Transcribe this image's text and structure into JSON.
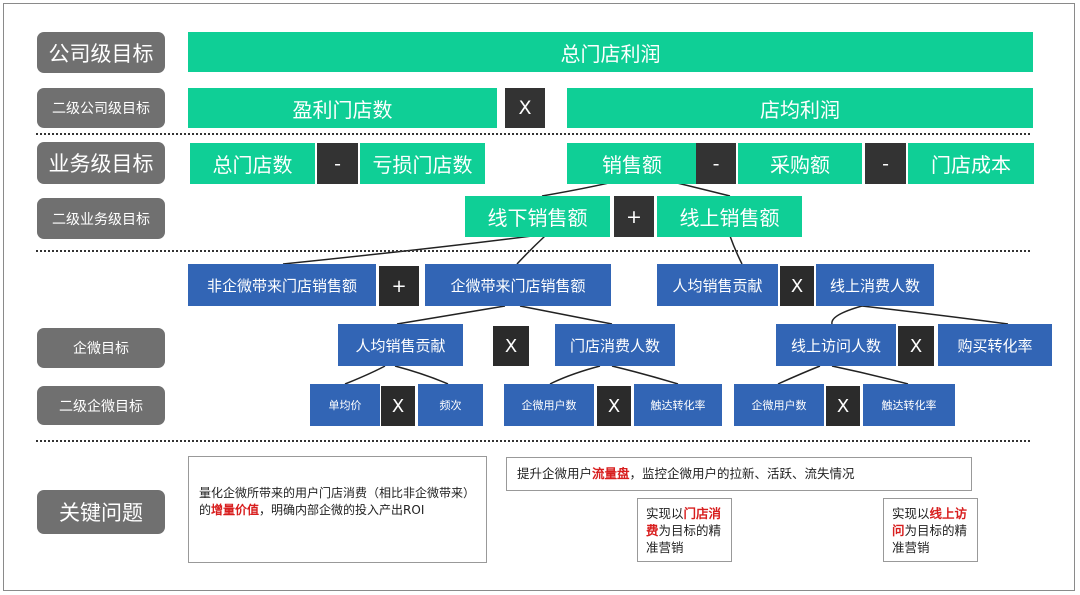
{
  "levels": {
    "company": "公司级目标",
    "company2": "二级公司级目标",
    "business": "业务级目标",
    "business2": "二级业务级目标",
    "wecom": "企微目标",
    "wecom2": "二级企微目标",
    "key": "关键问题"
  },
  "green": {
    "total_profit": "总门店利润",
    "profitable_stores": "盈利门店数",
    "avg_profit": "店均利润",
    "total_stores": "总门店数",
    "loss_stores": "亏损门店数",
    "sales": "销售额",
    "purchase": "采购额",
    "store_cost": "门店成本",
    "offline_sales": "线下销售额",
    "online_sales": "线上销售额"
  },
  "ops": {
    "times": "X",
    "minus": "-",
    "plus": "+"
  },
  "blue": {
    "non_wecom_sales": "非企微带来门店销售额",
    "wecom_sales": "企微带来门店销售额",
    "per_capita_left": "人均销售贡献",
    "online_consumers": "线上消费人数",
    "per_capita_mid": "人均销售贡献",
    "store_consumers": "门店消费人数",
    "online_visitors": "线上访问人数",
    "purchase_rate": "购买转化率",
    "unit_price": "单均价",
    "frequency": "频次",
    "wecom_users_a": "企微用户数",
    "reach_rate_a": "触达转化率",
    "wecom_users_b": "企微用户数",
    "reach_rate_b": "触达转化率"
  },
  "notes": {
    "left_a": "量化企微所带来的用户门店消费（相比非企微带来）的",
    "left_hl": "增量价值",
    "left_b": "，明确内部企微的投入产出ROI",
    "top_a": "提升企微用户",
    "top_hl": "流量盘",
    "top_b": "，监控企微用户的拉新、活跃、流失情况",
    "store_a": "实现以",
    "store_hl": "门店消费",
    "store_b": "为目标的精准营销",
    "online_a": "实现以",
    "online_hl": "线上访问",
    "online_b": "为目标的精准营销"
  },
  "colors": {
    "green": "#0fcf96",
    "blue": "#3265b5",
    "dark": "#333333",
    "label_gray": "#707070",
    "highlight_red": "#d81e1e"
  }
}
